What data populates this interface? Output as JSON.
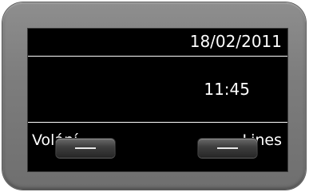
{
  "display": {
    "date": "18/02/2011",
    "time": "11:45",
    "softkeys": {
      "left_label": "Volání",
      "right_label": "Lines"
    }
  },
  "hardware": {
    "left_key_icon": "dash-icon",
    "right_key_icon": "dash-icon"
  },
  "colors": {
    "screen_bg": "#000000",
    "text": "#ffffff",
    "bezel": "#7d7d7d"
  }
}
